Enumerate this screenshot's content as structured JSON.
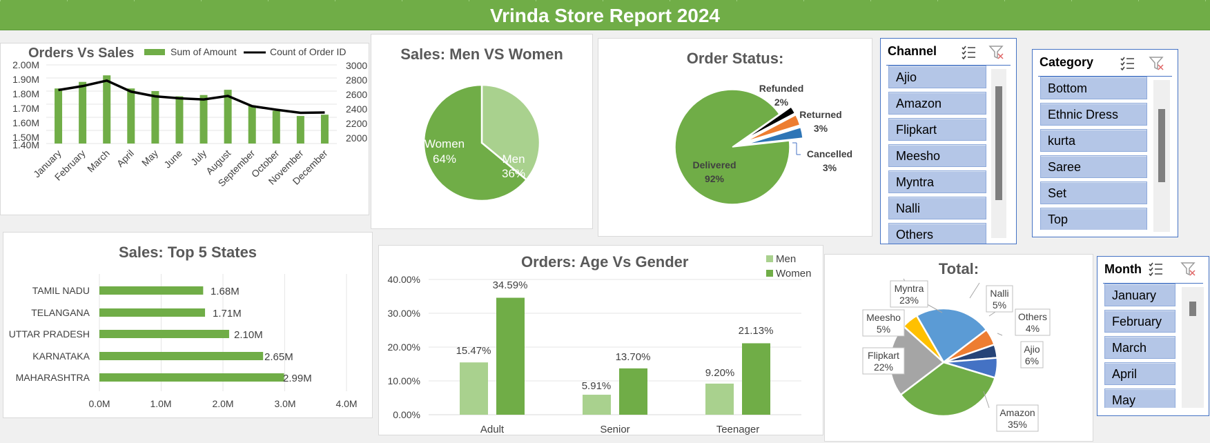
{
  "report_title": "Vrinda Store Report 2024",
  "charts": {
    "orders_vs_sales": {
      "title": "Orders Vs Sales",
      "legend": [
        "Sum of Amount",
        "Count of Order ID"
      ],
      "left_ticks": [
        "2.00M",
        "1.90M",
        "1.80M",
        "1.70M",
        "1.60M",
        "1.50M",
        "1.40M"
      ],
      "right_ticks": [
        "3000",
        "2800",
        "2600",
        "2400",
        "2200",
        "2000"
      ],
      "months": [
        "January",
        "February",
        "March",
        "April",
        "May",
        "June",
        "July",
        "August",
        "September",
        "October",
        "November",
        "December"
      ]
    },
    "men_vs_women": {
      "title": "Sales: Men VS Women",
      "labels": [
        {
          "name": "Men",
          "pct": "36%"
        },
        {
          "name": "Women",
          "pct": "64%"
        }
      ]
    },
    "order_status": {
      "title": "Order Status:",
      "labels": [
        {
          "name": "Delivered",
          "pct": "92%"
        },
        {
          "name": "Refunded",
          "pct": "2%"
        },
        {
          "name": "Returned",
          "pct": "3%"
        },
        {
          "name": "Cancelled",
          "pct": "3%"
        }
      ]
    },
    "top_states": {
      "title": "Sales: Top 5 States",
      "states": [
        "TAMIL NADU",
        "TELANGANA",
        "UTTAR PRADESH",
        "KARNATAKA",
        "MAHARASHTRA"
      ],
      "value_labels": [
        "1.68M",
        "1.71M",
        "2.10M",
        "2.65M",
        "2.99M"
      ],
      "x_ticks": [
        "0.0M",
        "1.0M",
        "2.0M",
        "3.0M",
        "4.0M"
      ]
    },
    "age_vs_gender": {
      "title": "Orders: Age Vs Gender",
      "legend": [
        "Men",
        "Women"
      ],
      "y_ticks": [
        "40.00%",
        "30.00%",
        "20.00%",
        "10.00%",
        "0.00%"
      ],
      "groups": [
        "Adult",
        "Senior",
        "Teenager"
      ],
      "men_labels": [
        "15.47%",
        "5.91%",
        "9.20%"
      ],
      "women_labels": [
        "34.59%",
        "13.70%",
        "21.13%"
      ]
    },
    "total": {
      "title": "Total:",
      "slices": [
        {
          "name": "Myntra",
          "pct": "23%"
        },
        {
          "name": "Nalli",
          "pct": "5%"
        },
        {
          "name": "Others",
          "pct": "4%"
        },
        {
          "name": "Ajio",
          "pct": "6%"
        },
        {
          "name": "Amazon",
          "pct": "35%"
        },
        {
          "name": "Flipkart",
          "pct": "22%"
        },
        {
          "name": "Meesho",
          "pct": "5%"
        }
      ]
    }
  },
  "chart_data": [
    {
      "type": "bar+line",
      "title": "Orders Vs Sales",
      "categories": [
        "January",
        "February",
        "March",
        "April",
        "May",
        "June",
        "July",
        "August",
        "September",
        "October",
        "November",
        "December"
      ],
      "series": [
        {
          "name": "Sum of Amount",
          "axis": "left",
          "values": [
            1.82,
            1.87,
            1.92,
            1.82,
            1.8,
            1.76,
            1.77,
            1.81,
            1.69,
            1.65,
            1.61,
            1.62
          ]
        },
        {
          "name": "Count of Order ID",
          "axis": "right",
          "values": [
            2680,
            2730,
            2800,
            2660,
            2600,
            2575,
            2560,
            2605,
            2475,
            2430,
            2390,
            2395
          ]
        }
      ],
      "ylim_left": [
        1.4,
        2.0
      ],
      "ylim_right": [
        2000,
        3000
      ]
    },
    {
      "type": "pie",
      "title": "Sales: Men VS Women",
      "categories": [
        "Men",
        "Women"
      ],
      "values": [
        36,
        64
      ]
    },
    {
      "type": "pie",
      "title": "Order Status:",
      "categories": [
        "Delivered",
        "Refunded",
        "Returned",
        "Cancelled"
      ],
      "values": [
        92,
        2,
        3,
        3
      ]
    },
    {
      "type": "bar",
      "orientation": "horizontal",
      "title": "Sales: Top 5 States",
      "categories": [
        "TAMIL NADU",
        "TELANGANA",
        "UTTAR PRADESH",
        "KARNATAKA",
        "MAHARASHTRA"
      ],
      "values": [
        1.68,
        1.71,
        2.1,
        2.65,
        2.99
      ],
      "xlim": [
        0,
        4
      ]
    },
    {
      "type": "bar",
      "title": "Orders: Age Vs Gender",
      "categories": [
        "Adult",
        "Senior",
        "Teenager"
      ],
      "series": [
        {
          "name": "Men",
          "values": [
            15.47,
            5.91,
            9.2
          ]
        },
        {
          "name": "Women",
          "values": [
            34.59,
            13.7,
            21.13
          ]
        }
      ],
      "ylim": [
        0,
        40
      ]
    },
    {
      "type": "pie",
      "title": "Total:",
      "categories": [
        "Myntra",
        "Nalli",
        "Others",
        "Ajio",
        "Amazon",
        "Flipkart",
        "Meesho"
      ],
      "values": [
        23,
        5,
        4,
        6,
        35,
        22,
        5
      ]
    }
  ],
  "slicers": {
    "channel": {
      "title": "Channel",
      "items": [
        "Ajio",
        "Amazon",
        "Flipkart",
        "Meesho",
        "Myntra",
        "Nalli",
        "Others"
      ]
    },
    "category": {
      "title": "Category",
      "items": [
        "Bottom",
        "Ethnic Dress",
        "kurta",
        "Saree",
        "Set",
        "Top"
      ]
    },
    "month": {
      "title": "Month",
      "items": [
        "January",
        "February",
        "March",
        "April",
        "May"
      ]
    }
  },
  "colors": {
    "green": "#70ad47",
    "light_green": "#a9d18e",
    "blue": "#5b9bd5",
    "orange": "#ed7d31",
    "gray": "#a5a5a5",
    "gold": "#ffc000",
    "navy": "#264478",
    "royal": "#4472c4",
    "black": "#000000"
  }
}
